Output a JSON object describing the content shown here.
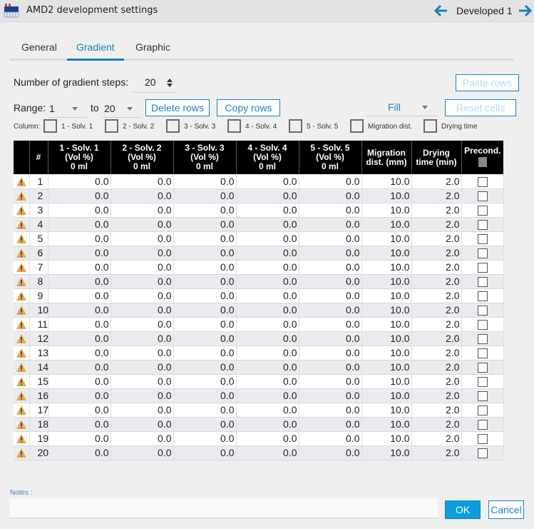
{
  "window": {
    "title": "AMD2 development settings",
    "app_icon": "amd2-device-icon",
    "nav_label": "Developed 1",
    "nav_prev_icon": "arrow-left-icon",
    "nav_next_icon": "arrow-right-icon"
  },
  "tabs": [
    {
      "label": "General",
      "active": false
    },
    {
      "label": "Gradient",
      "active": true
    },
    {
      "label": "Graphic",
      "active": false
    }
  ],
  "controls": {
    "steps_label": "Number of gradient steps:",
    "steps_value": "20",
    "paste_rows": "Paste rows",
    "range_label": "Range:",
    "range_from": "1",
    "to_label": "to",
    "range_to": "20",
    "delete_rows": "Delete rows",
    "copy_rows": "Copy rows",
    "fill_label": "Fill",
    "reset_cells": "Reset cells",
    "column_label": "Column:",
    "column_checks": [
      {
        "label": "1 - Solv. 1",
        "checked": false
      },
      {
        "label": "2 - Solv. 2",
        "checked": false
      },
      {
        "label": "3 - Solv. 3",
        "checked": false
      },
      {
        "label": "4 - Solv. 4",
        "checked": false
      },
      {
        "label": "5 - Solv. 5",
        "checked": false
      },
      {
        "label": "Migration dist.",
        "checked": false
      },
      {
        "label": "Drying time",
        "checked": false
      }
    ]
  },
  "table": {
    "headers": [
      {
        "lines": [
          ""
        ]
      },
      {
        "lines": [
          "#"
        ]
      },
      {
        "lines": [
          "1 - Solv. 1",
          "(Vol %)",
          "0 ml"
        ]
      },
      {
        "lines": [
          "2 - Solv. 2",
          "(Vol %)",
          "0 ml"
        ]
      },
      {
        "lines": [
          "3 - Solv. 3",
          "(Vol %)",
          "0 ml"
        ]
      },
      {
        "lines": [
          "4 - Solv. 4",
          "(Vol %)",
          "0 ml"
        ]
      },
      {
        "lines": [
          "5 - Solv. 5",
          "(Vol %)",
          "0 ml"
        ]
      },
      {
        "lines": [
          "Migration",
          "dist. (mm)"
        ]
      },
      {
        "lines": [
          "Drying",
          "time (min)"
        ]
      },
      {
        "lines": [
          "Precond."
        ]
      }
    ],
    "rows": [
      {
        "n": "1",
        "s1": "0.0",
        "s2": "0.0",
        "s3": "0.0",
        "s4": "0.0",
        "s5": "0.0",
        "mig": "10.0",
        "dry": "2.0",
        "precond": false,
        "warning": true
      },
      {
        "n": "2",
        "s1": "0.0",
        "s2": "0.0",
        "s3": "0.0",
        "s4": "0.0",
        "s5": "0.0",
        "mig": "10.0",
        "dry": "2.0",
        "precond": false,
        "warning": true
      },
      {
        "n": "3",
        "s1": "0.0",
        "s2": "0.0",
        "s3": "0.0",
        "s4": "0.0",
        "s5": "0.0",
        "mig": "10.0",
        "dry": "2.0",
        "precond": false,
        "warning": true
      },
      {
        "n": "4",
        "s1": "0.0",
        "s2": "0.0",
        "s3": "0.0",
        "s4": "0.0",
        "s5": "0.0",
        "mig": "10.0",
        "dry": "2.0",
        "precond": false,
        "warning": true
      },
      {
        "n": "5",
        "s1": "0.0",
        "s2": "0.0",
        "s3": "0.0",
        "s4": "0.0",
        "s5": "0.0",
        "mig": "10.0",
        "dry": "2.0",
        "precond": false,
        "warning": true
      },
      {
        "n": "6",
        "s1": "0.0",
        "s2": "0.0",
        "s3": "0.0",
        "s4": "0.0",
        "s5": "0.0",
        "mig": "10.0",
        "dry": "2.0",
        "precond": false,
        "warning": true
      },
      {
        "n": "7",
        "s1": "0.0",
        "s2": "0.0",
        "s3": "0.0",
        "s4": "0.0",
        "s5": "0.0",
        "mig": "10.0",
        "dry": "2.0",
        "precond": false,
        "warning": true
      },
      {
        "n": "8",
        "s1": "0.0",
        "s2": "0.0",
        "s3": "0.0",
        "s4": "0.0",
        "s5": "0.0",
        "mig": "10.0",
        "dry": "2.0",
        "precond": false,
        "warning": true
      },
      {
        "n": "9",
        "s1": "0.0",
        "s2": "0.0",
        "s3": "0.0",
        "s4": "0.0",
        "s5": "0.0",
        "mig": "10.0",
        "dry": "2.0",
        "precond": false,
        "warning": true
      },
      {
        "n": "10",
        "s1": "0.0",
        "s2": "0.0",
        "s3": "0.0",
        "s4": "0.0",
        "s5": "0.0",
        "mig": "10.0",
        "dry": "2.0",
        "precond": false,
        "warning": true
      },
      {
        "n": "11",
        "s1": "0.0",
        "s2": "0.0",
        "s3": "0.0",
        "s4": "0.0",
        "s5": "0.0",
        "mig": "10.0",
        "dry": "2.0",
        "precond": false,
        "warning": true
      },
      {
        "n": "12",
        "s1": "0.0",
        "s2": "0.0",
        "s3": "0.0",
        "s4": "0.0",
        "s5": "0.0",
        "mig": "10.0",
        "dry": "2.0",
        "precond": false,
        "warning": true
      },
      {
        "n": "13",
        "s1": "0.0",
        "s2": "0.0",
        "s3": "0.0",
        "s4": "0.0",
        "s5": "0.0",
        "mig": "10.0",
        "dry": "2.0",
        "precond": false,
        "warning": true
      },
      {
        "n": "14",
        "s1": "0.0",
        "s2": "0.0",
        "s3": "0.0",
        "s4": "0.0",
        "s5": "0.0",
        "mig": "10.0",
        "dry": "2.0",
        "precond": false,
        "warning": true
      },
      {
        "n": "15",
        "s1": "0.0",
        "s2": "0.0",
        "s3": "0.0",
        "s4": "0.0",
        "s5": "0.0",
        "mig": "10.0",
        "dry": "2.0",
        "precond": false,
        "warning": true
      },
      {
        "n": "16",
        "s1": "0.0",
        "s2": "0.0",
        "s3": "0.0",
        "s4": "0.0",
        "s5": "0.0",
        "mig": "10.0",
        "dry": "2.0",
        "precond": false,
        "warning": true
      },
      {
        "n": "17",
        "s1": "0.0",
        "s2": "0.0",
        "s3": "0.0",
        "s4": "0.0",
        "s5": "0.0",
        "mig": "10.0",
        "dry": "2.0",
        "precond": false,
        "warning": true
      },
      {
        "n": "18",
        "s1": "0.0",
        "s2": "0.0",
        "s3": "0.0",
        "s4": "0.0",
        "s5": "0.0",
        "mig": "10.0",
        "dry": "2.0",
        "precond": false,
        "warning": true
      },
      {
        "n": "19",
        "s1": "0.0",
        "s2": "0.0",
        "s3": "0.0",
        "s4": "0.0",
        "s5": "0.0",
        "mig": "10.0",
        "dry": "2.0",
        "precond": false,
        "warning": true
      },
      {
        "n": "20",
        "s1": "0.0",
        "s2": "0.0",
        "s3": "0.0",
        "s4": "0.0",
        "s5": "0.0",
        "mig": "10.0",
        "dry": "2.0",
        "precond": false,
        "warning": true
      }
    ]
  },
  "footer": {
    "notes_label": "Notes :",
    "notes_value": "",
    "ok": "OK",
    "cancel": "Cancel"
  },
  "colors": {
    "accent": "#1a7fc1",
    "ok_bg": "#0b9de0",
    "warning": "#e8a94a",
    "header_bg": "#000000",
    "row_alt": "#e9ebef"
  }
}
